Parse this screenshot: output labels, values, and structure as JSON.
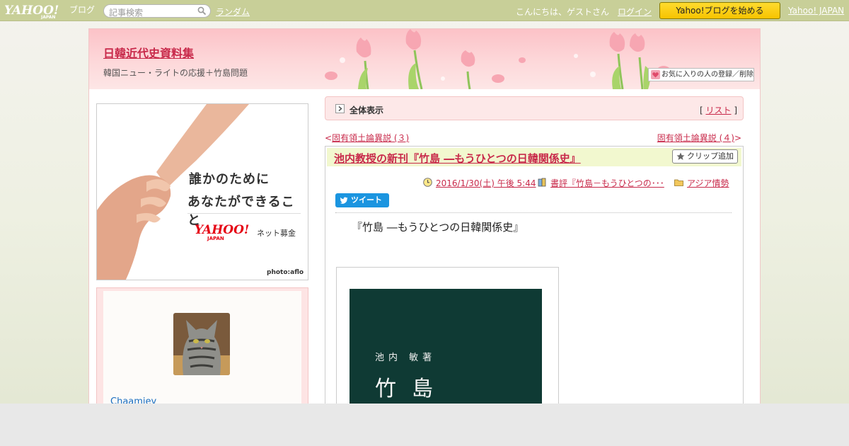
{
  "topbar": {
    "logo_text": "YAHOO!",
    "logo_sub": "JAPAN",
    "logo_blog": "ブログ",
    "search_placeholder": "記事検索",
    "random_link": "ランダム",
    "greeting": "こんにちは、ゲストさん",
    "login_link": "ログイン",
    "start_button": "Yahoo!ブログを始める",
    "yahoo_japan_link": "Yahoo! JAPAN"
  },
  "header": {
    "blog_title": "日韓近代史資料集",
    "blog_subtitle": "韓国ニュー・ライトの応援＋竹島問題",
    "favorite_button": "お気に入りの人の登録／削除"
  },
  "banner": {
    "line1": "誰かのために",
    "line2": "あなたができること",
    "logo": "YAHOO!",
    "logo_sub": "JAPAN",
    "service": "ネット募金",
    "credit": "photo:aflo"
  },
  "profile": {
    "name": "Chaamiey"
  },
  "allview": {
    "label": "全体表示",
    "list_link": "リスト"
  },
  "nav": {
    "prev": "固有領土論異説 (３)",
    "next": "固有領土論異説 (４)"
  },
  "article": {
    "title": "池内教授の新刊『竹島 ―もうひとつの日韓関係史』",
    "clip_button": "クリップ追加",
    "date": "2016/1/30(土) 午後 5:44",
    "category": "書評『竹島－もうひとつの･･･",
    "folder": "アジア情勢",
    "tweet_button": "ツイート",
    "book_heading": "『竹島 ―もうひとつの日韓関係史』",
    "cover_author": "池内 敏著",
    "cover_title": "竹島"
  },
  "colors": {
    "topbar": "#c8cf98",
    "accent_link": "#c8294a",
    "start_button": "#f7c300",
    "tweet": "#1b95e0",
    "book_cover": "#0f3a34"
  }
}
